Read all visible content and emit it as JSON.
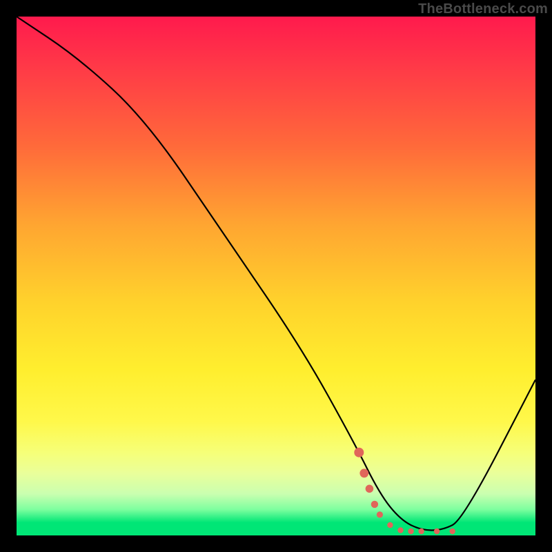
{
  "watermark": "TheBottleneck.com",
  "chart_data": {
    "type": "line",
    "title": "",
    "xlabel": "",
    "ylabel": "",
    "xlim": [
      0,
      100
    ],
    "ylim": [
      0,
      100
    ],
    "grid": false,
    "legend": false,
    "background_gradient": {
      "direction": "vertical",
      "stops": [
        {
          "pos": 0,
          "color": "#ff1a4d"
        },
        {
          "pos": 25,
          "color": "#ff6a3a"
        },
        {
          "pos": 55,
          "color": "#ffd22c"
        },
        {
          "pos": 78,
          "color": "#fff84a"
        },
        {
          "pos": 92,
          "color": "#caffb0"
        },
        {
          "pos": 100,
          "color": "#00e676"
        }
      ]
    },
    "series": [
      {
        "name": "bottleneck-curve",
        "style": "black-line",
        "x": [
          0,
          12,
          25,
          40,
          55,
          65,
          70,
          74,
          78,
          82,
          86,
          100
        ],
        "y": [
          100,
          92,
          80,
          58,
          36,
          18,
          8,
          3,
          1,
          1,
          3,
          30
        ]
      },
      {
        "name": "optimal-range-marker",
        "style": "coral-dots",
        "color": "#e0665a",
        "x": [
          66,
          67,
          68,
          69,
          70,
          72,
          74,
          76,
          78,
          81,
          84
        ],
        "y": [
          16,
          12,
          9,
          6,
          4,
          2,
          1,
          0.8,
          0.8,
          0.8,
          0.8
        ]
      }
    ]
  }
}
